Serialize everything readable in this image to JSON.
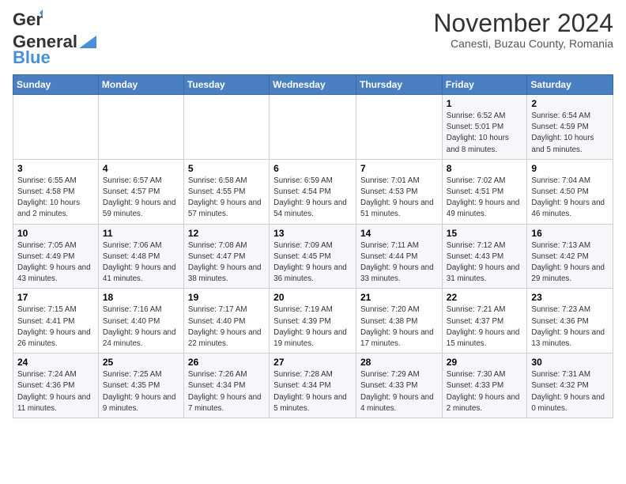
{
  "logo": {
    "general": "General",
    "blue": "Blue"
  },
  "title": "November 2024",
  "subtitle": "Canesti, Buzau County, Romania",
  "header_days": [
    "Sunday",
    "Monday",
    "Tuesday",
    "Wednesday",
    "Thursday",
    "Friday",
    "Saturday"
  ],
  "weeks": [
    [
      {
        "day": "",
        "info": ""
      },
      {
        "day": "",
        "info": ""
      },
      {
        "day": "",
        "info": ""
      },
      {
        "day": "",
        "info": ""
      },
      {
        "day": "",
        "info": ""
      },
      {
        "day": "1",
        "info": "Sunrise: 6:52 AM\nSunset: 5:01 PM\nDaylight: 10 hours and 8 minutes."
      },
      {
        "day": "2",
        "info": "Sunrise: 6:54 AM\nSunset: 4:59 PM\nDaylight: 10 hours and 5 minutes."
      }
    ],
    [
      {
        "day": "3",
        "info": "Sunrise: 6:55 AM\nSunset: 4:58 PM\nDaylight: 10 hours and 2 minutes."
      },
      {
        "day": "4",
        "info": "Sunrise: 6:57 AM\nSunset: 4:57 PM\nDaylight: 9 hours and 59 minutes."
      },
      {
        "day": "5",
        "info": "Sunrise: 6:58 AM\nSunset: 4:55 PM\nDaylight: 9 hours and 57 minutes."
      },
      {
        "day": "6",
        "info": "Sunrise: 6:59 AM\nSunset: 4:54 PM\nDaylight: 9 hours and 54 minutes."
      },
      {
        "day": "7",
        "info": "Sunrise: 7:01 AM\nSunset: 4:53 PM\nDaylight: 9 hours and 51 minutes."
      },
      {
        "day": "8",
        "info": "Sunrise: 7:02 AM\nSunset: 4:51 PM\nDaylight: 9 hours and 49 minutes."
      },
      {
        "day": "9",
        "info": "Sunrise: 7:04 AM\nSunset: 4:50 PM\nDaylight: 9 hours and 46 minutes."
      }
    ],
    [
      {
        "day": "10",
        "info": "Sunrise: 7:05 AM\nSunset: 4:49 PM\nDaylight: 9 hours and 43 minutes."
      },
      {
        "day": "11",
        "info": "Sunrise: 7:06 AM\nSunset: 4:48 PM\nDaylight: 9 hours and 41 minutes."
      },
      {
        "day": "12",
        "info": "Sunrise: 7:08 AM\nSunset: 4:47 PM\nDaylight: 9 hours and 38 minutes."
      },
      {
        "day": "13",
        "info": "Sunrise: 7:09 AM\nSunset: 4:45 PM\nDaylight: 9 hours and 36 minutes."
      },
      {
        "day": "14",
        "info": "Sunrise: 7:11 AM\nSunset: 4:44 PM\nDaylight: 9 hours and 33 minutes."
      },
      {
        "day": "15",
        "info": "Sunrise: 7:12 AM\nSunset: 4:43 PM\nDaylight: 9 hours and 31 minutes."
      },
      {
        "day": "16",
        "info": "Sunrise: 7:13 AM\nSunset: 4:42 PM\nDaylight: 9 hours and 29 minutes."
      }
    ],
    [
      {
        "day": "17",
        "info": "Sunrise: 7:15 AM\nSunset: 4:41 PM\nDaylight: 9 hours and 26 minutes."
      },
      {
        "day": "18",
        "info": "Sunrise: 7:16 AM\nSunset: 4:40 PM\nDaylight: 9 hours and 24 minutes."
      },
      {
        "day": "19",
        "info": "Sunrise: 7:17 AM\nSunset: 4:40 PM\nDaylight: 9 hours and 22 minutes."
      },
      {
        "day": "20",
        "info": "Sunrise: 7:19 AM\nSunset: 4:39 PM\nDaylight: 9 hours and 19 minutes."
      },
      {
        "day": "21",
        "info": "Sunrise: 7:20 AM\nSunset: 4:38 PM\nDaylight: 9 hours and 17 minutes."
      },
      {
        "day": "22",
        "info": "Sunrise: 7:21 AM\nSunset: 4:37 PM\nDaylight: 9 hours and 15 minutes."
      },
      {
        "day": "23",
        "info": "Sunrise: 7:23 AM\nSunset: 4:36 PM\nDaylight: 9 hours and 13 minutes."
      }
    ],
    [
      {
        "day": "24",
        "info": "Sunrise: 7:24 AM\nSunset: 4:36 PM\nDaylight: 9 hours and 11 minutes."
      },
      {
        "day": "25",
        "info": "Sunrise: 7:25 AM\nSunset: 4:35 PM\nDaylight: 9 hours and 9 minutes."
      },
      {
        "day": "26",
        "info": "Sunrise: 7:26 AM\nSunset: 4:34 PM\nDaylight: 9 hours and 7 minutes."
      },
      {
        "day": "27",
        "info": "Sunrise: 7:28 AM\nSunset: 4:34 PM\nDaylight: 9 hours and 5 minutes."
      },
      {
        "day": "28",
        "info": "Sunrise: 7:29 AM\nSunset: 4:33 PM\nDaylight: 9 hours and 4 minutes."
      },
      {
        "day": "29",
        "info": "Sunrise: 7:30 AM\nSunset: 4:33 PM\nDaylight: 9 hours and 2 minutes."
      },
      {
        "day": "30",
        "info": "Sunrise: 7:31 AM\nSunset: 4:32 PM\nDaylight: 9 hours and 0 minutes."
      }
    ]
  ]
}
